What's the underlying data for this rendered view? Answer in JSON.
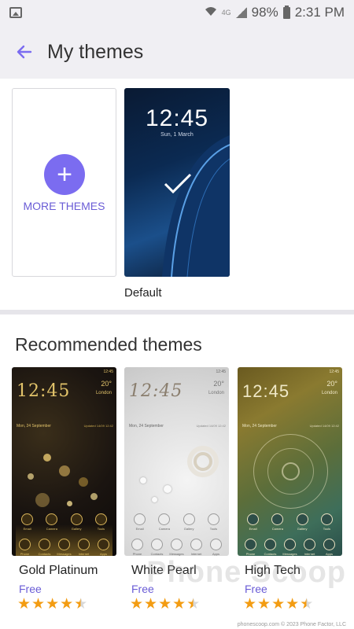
{
  "status": {
    "network": "4G",
    "battery": "98%",
    "time": "2:31 PM"
  },
  "header": {
    "title": "My themes"
  },
  "my_themes": {
    "more_label": "MORE THEMES",
    "default": {
      "label": "Default",
      "clock": "12:45",
      "date": "Sun, 1 March"
    }
  },
  "recommended": {
    "title": "Recommended themes",
    "themes": [
      {
        "name": "Gold Platinum",
        "price": "Free",
        "rating": 4.5,
        "clock": "12:45",
        "date": "Mon, 24 September",
        "temp": "20°",
        "location": "London",
        "updated": "Updated 14/09 12:42",
        "time": "12:45",
        "icons_row1": [
          "Email",
          "Camera",
          "Gallery",
          "Tools"
        ],
        "icons_row2": [
          "Phone",
          "Contacts",
          "Messages",
          "Internet",
          "Apps"
        ]
      },
      {
        "name": "White Pearl",
        "price": "Free",
        "rating": 4.5,
        "clock": "12:45",
        "date": "Mon, 24 September",
        "temp": "20°",
        "location": "London",
        "updated": "Updated 14/09 12:42",
        "time": "12:45",
        "icons_row1": [
          "Email",
          "Camera",
          "Gallery",
          "Tools"
        ],
        "icons_row2": [
          "Phone",
          "Contacts",
          "Messages",
          "Internet",
          "Apps"
        ]
      },
      {
        "name": "High Tech",
        "price": "Free",
        "rating": 4.5,
        "clock": "12:45",
        "date": "Mon, 24 September",
        "temp": "20°",
        "location": "London",
        "updated": "Updated 14/09 12:42",
        "time": "12:45",
        "icons_row1": [
          "Email",
          "Camera",
          "Gallery",
          "Tools"
        ],
        "icons_row2": [
          "Phone",
          "Contacts",
          "Messages",
          "Internet",
          "Apps"
        ]
      }
    ]
  },
  "watermark": {
    "text": "Phone Scoop",
    "credit": "phonescoop.com  © 2023 Phone Factor, LLC"
  },
  "colors": {
    "accent": "#7b6cf0",
    "star": "#f39c12"
  }
}
